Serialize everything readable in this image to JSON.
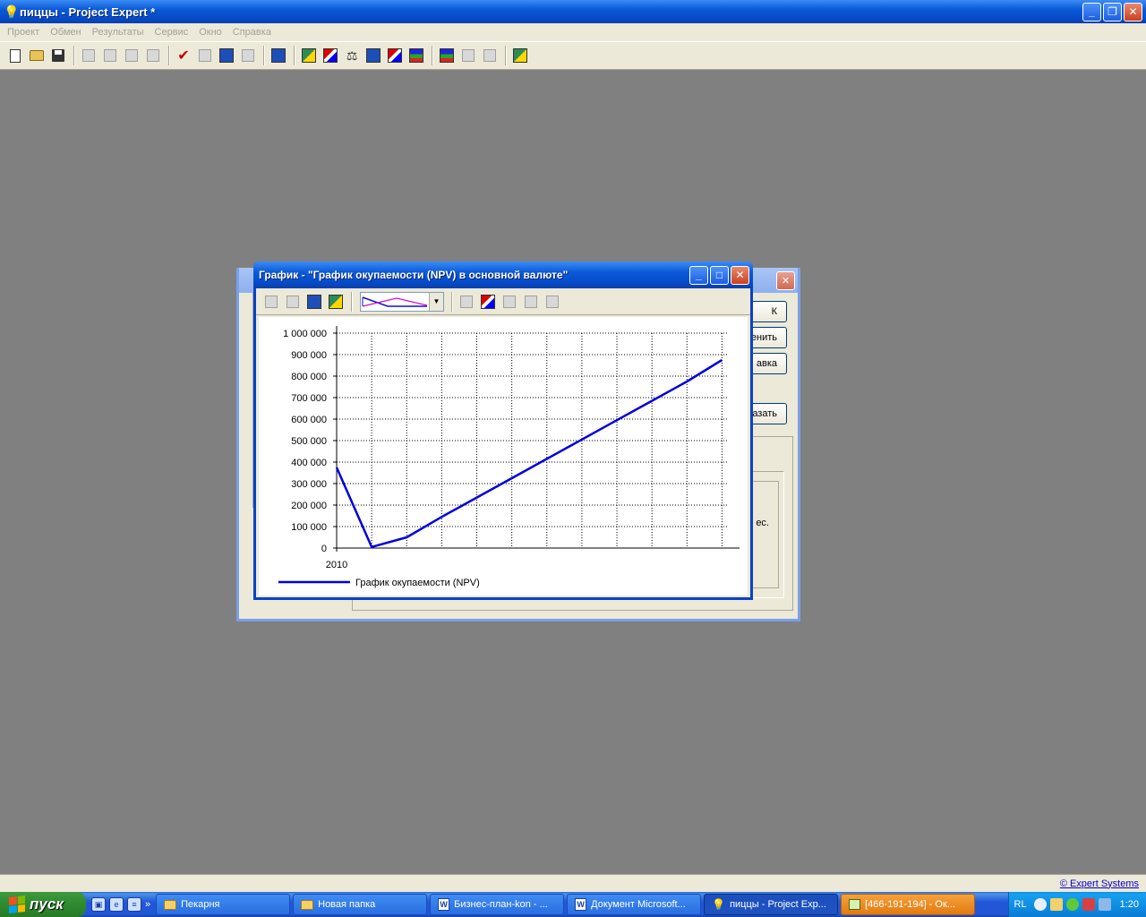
{
  "app": {
    "title": "пиццы - Project Expert *",
    "minimize": "_",
    "restore": "❐",
    "close": "✕"
  },
  "menu": [
    "Проект",
    "Обмен",
    "Результаты",
    "Сервис",
    "Окно",
    "Справка"
  ],
  "bg_dialog": {
    "buttons": [
      "К",
      "енить",
      "авка",
      "азать"
    ],
    "panel_text": "ес."
  },
  "chart_window": {
    "title": "График - \"График окупаемости (NPV) в основной валюте\"",
    "minimize": "_",
    "maximize": "□",
    "close": "✕",
    "dropdown_arrow": "▼"
  },
  "chart_data": {
    "type": "line",
    "title": "",
    "xlabel": "",
    "ylabel": "",
    "x_tick_label": "2010",
    "x_index": [
      0,
      1,
      2,
      3,
      4,
      5,
      6,
      7,
      8,
      9,
      10,
      11
    ],
    "y_ticks": [
      "1 000 000",
      "900 000",
      "800 000",
      "700 000",
      "600 000",
      "500 000",
      "400 000",
      "300 000",
      "200 000",
      "100 000",
      "0"
    ],
    "ylim": [
      0,
      1000000
    ],
    "xlim": [
      0,
      11.5
    ],
    "grid": true,
    "legend_position": "bottom-left",
    "series": [
      {
        "name": "График окупаемости (NPV)",
        "color": "#0000dd",
        "values": [
          375000,
          5000,
          50000,
          145000,
          235000,
          325000,
          415000,
          505000,
          595000,
          685000,
          775000,
          875000
        ]
      }
    ]
  },
  "statusbar": {
    "link": "© Expert Systems"
  },
  "taskbar": {
    "start": "пуск",
    "quick_more": "»",
    "tasks": [
      {
        "label": "Пекарня",
        "icon": "folder"
      },
      {
        "label": "Новая папка",
        "icon": "folder"
      },
      {
        "label": "Бизнес-план-kon - ...",
        "icon": "word"
      },
      {
        "label": "Документ Microsoft...",
        "icon": "word"
      },
      {
        "label": "пиццы - Project Exp...",
        "icon": "bulb"
      },
      {
        "label": "[466-191-194] - Ок...",
        "icon": "calc"
      }
    ],
    "lang": "RL",
    "time": "1:20"
  },
  "colors": {
    "accent_blue": "#0a5ad8",
    "workspace_gray": "#808080",
    "series_line": "#0000dd"
  }
}
